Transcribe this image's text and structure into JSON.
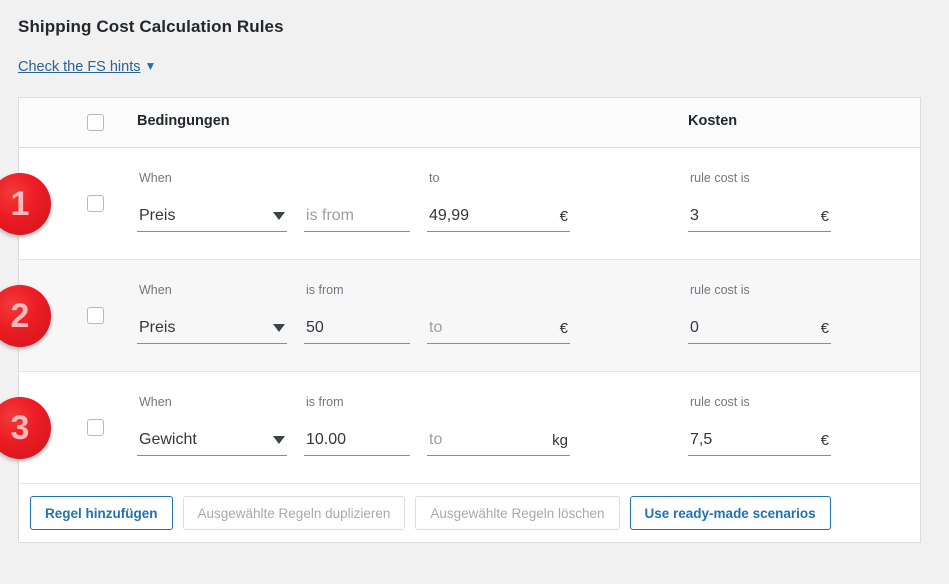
{
  "header": {
    "title": "Shipping Cost Calculation Rules",
    "hints_link": "Check the FS hints",
    "hints_caret": "▼"
  },
  "table": {
    "columns": {
      "conditions": "Bedingungen",
      "cost": "Kosten"
    },
    "rows": [
      {
        "badge": "1",
        "when_label": "When",
        "when_value": "Preis",
        "from_label": "",
        "from_value": "",
        "from_placeholder": "is from",
        "to_label": "to",
        "to_value": "49,99",
        "to_placeholder": "",
        "unit": "€",
        "cost_label": "rule cost is",
        "cost_value": "3",
        "cost_unit": "€"
      },
      {
        "badge": "2",
        "when_label": "When",
        "when_value": "Preis",
        "from_label": "is from",
        "from_value": "50",
        "from_placeholder": "",
        "to_label": "",
        "to_value": "",
        "to_placeholder": "to",
        "unit": "€",
        "cost_label": "rule cost is",
        "cost_value": "0",
        "cost_unit": "€"
      },
      {
        "badge": "3",
        "when_label": "When",
        "when_value": "Gewicht",
        "from_label": "is from",
        "from_value": "10.00",
        "from_placeholder": "",
        "to_label": "",
        "to_value": "",
        "to_placeholder": "to",
        "unit": "kg",
        "cost_label": "rule cost is",
        "cost_value": "7,5",
        "cost_unit": "€"
      }
    ]
  },
  "footer": {
    "add_rule": "Regel hinzufügen",
    "duplicate_selected": "Ausgewählte Regeln duplizieren",
    "delete_selected": "Ausgewählte Regeln löschen",
    "ready_made": "Use ready-made scenarios"
  },
  "colors": {
    "accent_blue": "#2271b1",
    "link_blue": "#2a6496",
    "badge_red": "#ed1c24",
    "page_bg": "#f1f1f1",
    "row_alt_bg": "#f7f7f7",
    "disabled_text": "#a7aaad"
  }
}
